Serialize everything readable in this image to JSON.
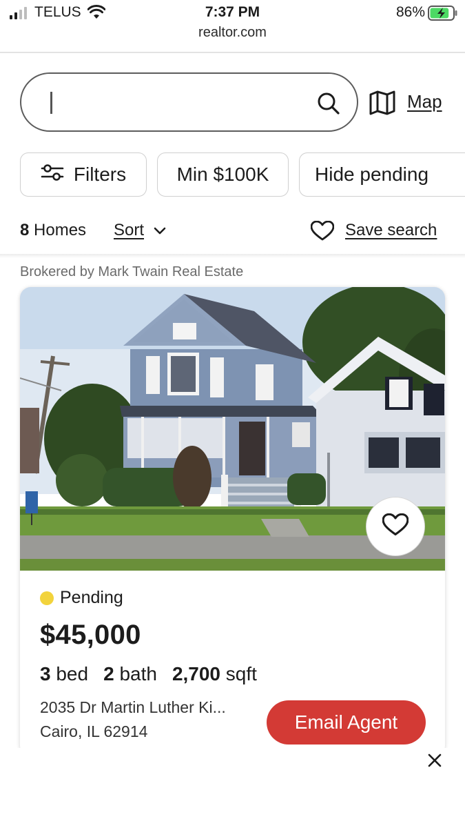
{
  "status_bar": {
    "carrier": "TELUS",
    "time": "7:37 PM",
    "battery_percent": "86%",
    "battery_level": 0.86,
    "icons": [
      "signal-icon",
      "wifi-icon",
      "battery-charging-icon"
    ]
  },
  "browser": {
    "url": "realtor.com"
  },
  "search": {
    "value": "",
    "placeholder": "",
    "search_icon": "search-icon",
    "map_icon": "map-icon",
    "map_label": "Map"
  },
  "filters": {
    "filters_icon": "sliders-icon",
    "filters_label": "Filters",
    "min_price_label": "Min $100K",
    "hide_pending_label": "Hide pending"
  },
  "results": {
    "count": "8",
    "count_suffix": "Homes",
    "sort_label": "Sort",
    "save_search_label": "Save search",
    "icons": [
      "chevron-down-icon",
      "heart-icon"
    ]
  },
  "listing": {
    "broker": "Brokered by Mark Twain Real Estate",
    "status": "Pending",
    "status_color": "#f2d33c",
    "price": "$45,000",
    "beds": "3",
    "beds_label": "bed",
    "baths": "2",
    "baths_label": "bath",
    "sqft": "2,700",
    "sqft_label": "sqft",
    "address_line1": "2035 Dr Martin Luther Ki...",
    "address_line2": "Cairo, IL 62914",
    "email_agent_label": "Email Agent",
    "cta_color": "#d33a35",
    "photo_alt": "Blue two-story house with porch"
  },
  "overlay": {
    "close_icon": "close-icon"
  }
}
